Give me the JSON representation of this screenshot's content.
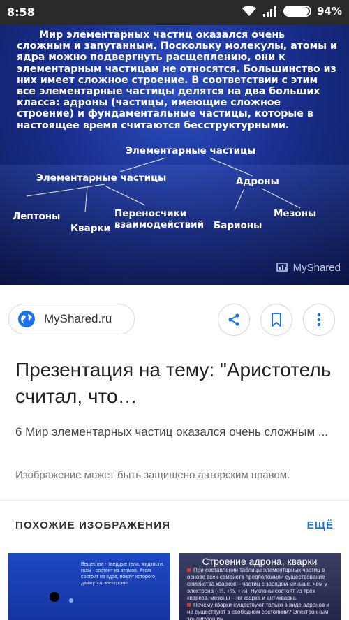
{
  "status_bar": {
    "time": "8:58",
    "battery": "94%",
    "battery_level": 0.94
  },
  "slide": {
    "paragraph": "Мир элементарных частиц оказался очень сложным и запутанным. Поскольку молекулы, атомы и ядра можно подвергнуть расщеплению, они к элементарным частицам не относятся. Большинство из них имеет сложное строение. В соответствии с этим все элементарные частицы делятся на два больших класса: адроны (частицы, имеющие сложное строение) и фундаментальные частицы, которые в настоящее время считаются бесструктурными.",
    "diagram": {
      "root": "Элементарные частицы",
      "left_node": "Элементарные частицы",
      "right_node": "Адроны",
      "leptons": "Лептоны",
      "quarks": "Кварки",
      "carriers_1": "Переносчики",
      "carriers_2": "взаимодействий",
      "baryons": "Барионы",
      "mesons": "Мезоны"
    },
    "watermark": "MyShared"
  },
  "source": {
    "name": "MyShared.ru"
  },
  "result": {
    "title": "Презентация на тему: \"Аристотель считал, что…",
    "snippet": "6 Мир элементарных частиц оказался очень сложным ...",
    "copyright_note": "Изображение может быть защищено авторским правом."
  },
  "similar": {
    "heading": "ПОХОЖИЕ ИЗОБРАЖЕНИЯ",
    "more_label": "ЕЩЁ",
    "thumb1_text": "Вещества - твердые тела, жидкости, газы - состоят из атомов. Атом состоит из ядра, вокруг которого движутся электроны",
    "thumb2_title": "Строение адрона, кварки",
    "thumb2_bullet1": "При составлении таблицы элементарных частиц в основе всех семейств предположили существование семейства кварков – частиц с зарядом меньше, чем у электрона (-⅓, +⅔, +⅓). Нуклоны состоят из трёх кварков, мезоны – из кварка и антикварка.",
    "thumb2_bullet2": "Почему кварки существуют только в виде адронов и не существуют в свободном состоянии? Электронным зондирующим"
  }
}
